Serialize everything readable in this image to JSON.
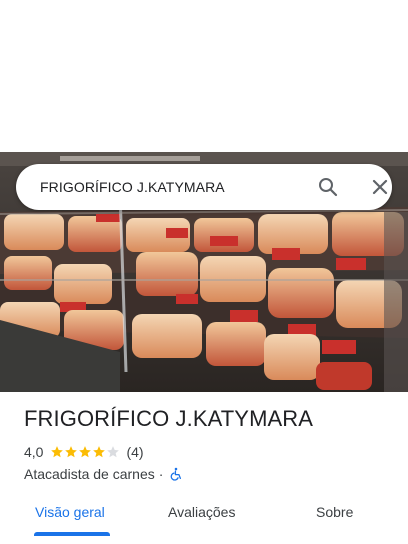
{
  "search": {
    "query": "FRIGORÍFICO J.KATYMARA"
  },
  "place": {
    "name": "FRIGORÍFICO J.KATYMARA",
    "rating": "4,0",
    "rating_fraction": 0.8,
    "review_count": "(4)",
    "category": "Atacadista de carnes",
    "separator": "·"
  },
  "icons": {
    "search": "search-icon",
    "close": "close-icon",
    "star": "star-icon",
    "wheelchair": "wheelchair-accessible-icon"
  },
  "tabs": [
    {
      "label": "Visão geral",
      "active": true
    },
    {
      "label": "Avaliações",
      "active": false
    },
    {
      "label": "Sobre",
      "active": false
    }
  ],
  "colors": {
    "accent": "#1a73e8",
    "star_filled": "#fbbc04",
    "star_empty": "#dadce0"
  }
}
